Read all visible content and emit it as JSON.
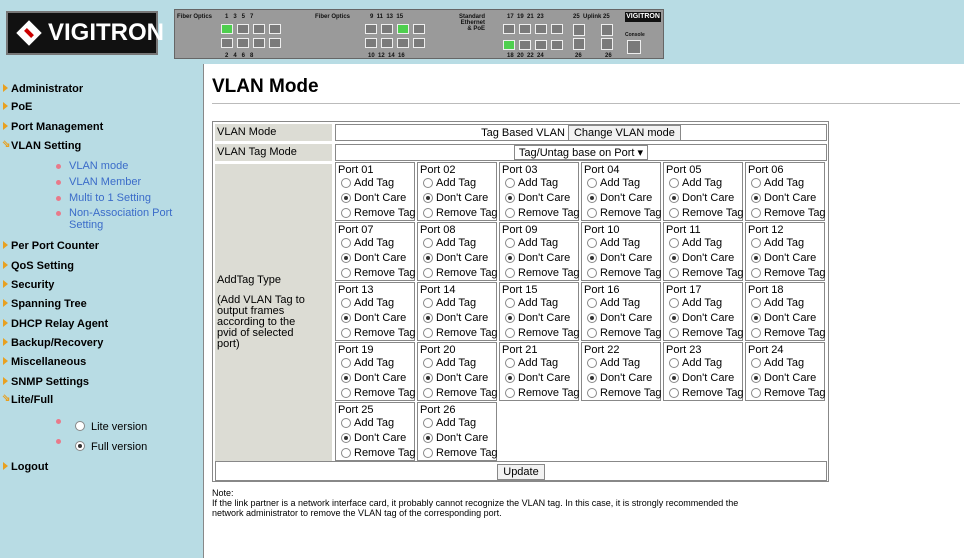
{
  "header": {
    "logo_text": "VIGITRON",
    "panel": {
      "fiber_optics_1": "Fiber Optics",
      "fiber_optics_2": "Fiber Optics",
      "standard": "Standard\nEthernet\n& PoE",
      "uplink": "Uplink",
      "console": "Console",
      "brand": "VIGITRON",
      "top_nums_1": "1   3   5   7",
      "bot_nums_1": "2   4   6   8",
      "top_nums_2": "9  11  13  15",
      "bot_nums_2": "10  12  14  16",
      "top_nums_3": "17  19  21  23",
      "bot_nums_3": "18  20  22  24",
      "top_nums_4": "25",
      "bot_nums_4": "26",
      "top_nums_5": "25",
      "bot_nums_5": "26"
    }
  },
  "sidebar": {
    "items": [
      {
        "label": "Administrator",
        "open": false
      },
      {
        "label": "PoE",
        "open": false
      },
      {
        "label": "Port Management",
        "open": false
      },
      {
        "label": "VLAN Setting",
        "open": true
      },
      {
        "label": "Per Port Counter",
        "open": false
      },
      {
        "label": "QoS Setting",
        "open": false
      },
      {
        "label": "Security",
        "open": false
      },
      {
        "label": "Spanning Tree",
        "open": false
      },
      {
        "label": "DHCP Relay Agent",
        "open": false
      },
      {
        "label": "Backup/Recovery",
        "open": false
      },
      {
        "label": "Miscellaneous",
        "open": false
      },
      {
        "label": "SNMP Settings",
        "open": false
      },
      {
        "label": "Lite/Full",
        "open": true
      },
      {
        "label": "Logout",
        "open": false
      }
    ],
    "vlan_sub": [
      "VLAN mode",
      "VLAN Member",
      "Multi to 1 Setting",
      "Non-Association Port\nSetting"
    ],
    "lite_full": [
      {
        "label": "Lite version",
        "selected": false
      },
      {
        "label": "Full version",
        "selected": true
      }
    ]
  },
  "main": {
    "title": "VLAN Mode",
    "vlan_mode_label": "VLAN Mode",
    "vlan_mode_value": "Tag Based VLAN",
    "change_mode_button": "Change VLAN mode",
    "vlan_tag_mode_label": "VLAN Tag Mode",
    "vlan_tag_mode_value": "Tag/Untag base on Port",
    "addtag_label": "AddTag Type",
    "addtag_desc": "(Add VLAN Tag to output frames according to the pvid of selected port)",
    "options": [
      "Add Tag",
      "Don't Care",
      "Remove Tag"
    ],
    "ports": [
      "Port 01",
      "Port 02",
      "Port 03",
      "Port 04",
      "Port 05",
      "Port 06",
      "Port 07",
      "Port 08",
      "Port 09",
      "Port 10",
      "Port 11",
      "Port 12",
      "Port 13",
      "Port 14",
      "Port 15",
      "Port 16",
      "Port 17",
      "Port 18",
      "Port 19",
      "Port 20",
      "Port 21",
      "Port 22",
      "Port 23",
      "Port 24",
      "Port 25",
      "Port 26"
    ],
    "selected_option": "Don't Care",
    "update_button": "Update",
    "note_title": "Note:",
    "note_text": "If the link partner is a network interface card, it probably cannot recognize the VLAN tag. In this case, it is strongly recommended the network administrator to remove the VLAN tag of the corresponding port."
  }
}
